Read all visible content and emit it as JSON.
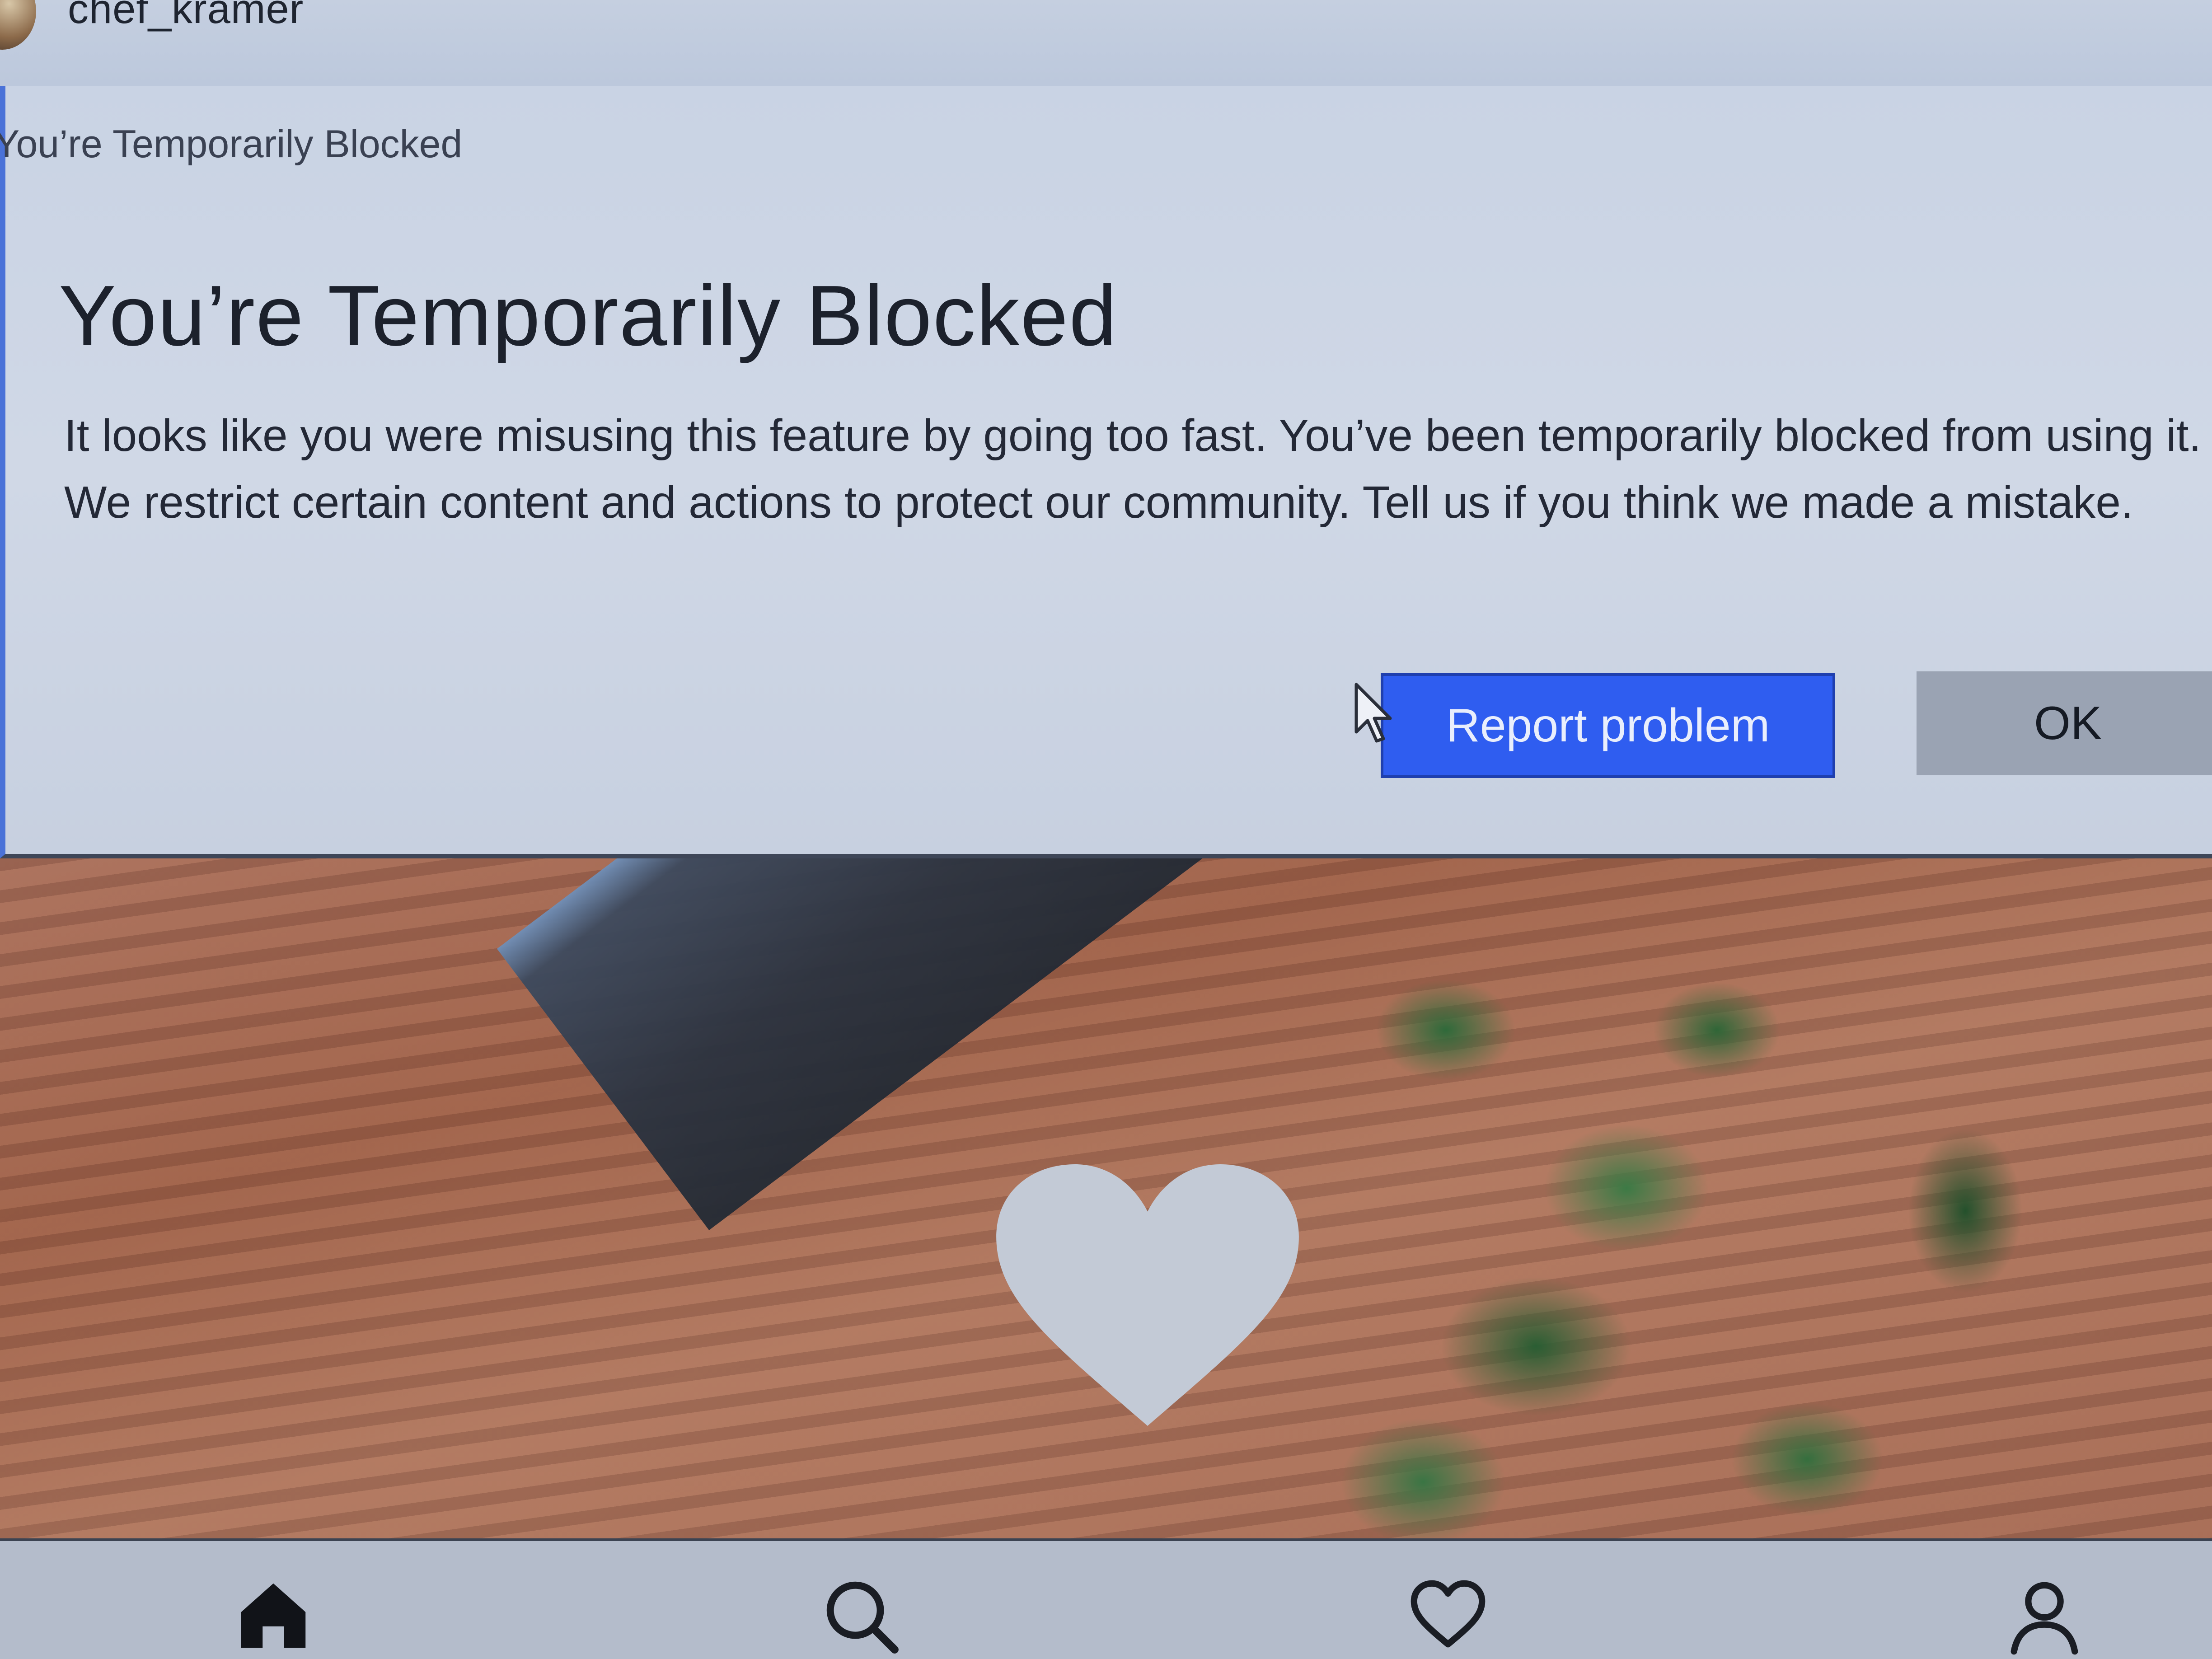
{
  "post": {
    "username": "chef_kramer"
  },
  "dialog": {
    "window_title": "You’re Temporarily Blocked",
    "heading": "You’re Temporarily Blocked",
    "message": "It looks like you were misusing this feature by going too fast. You’ve been temporarily blocked from using it. We restrict certain content and actions to protect our community. Tell us if you think we made a mistake.",
    "report_label": "Report problem",
    "ok_label": "OK"
  },
  "colors": {
    "accent_blue": "#2f5df0",
    "ok_button_gray": "#9aa3b3",
    "dialog_background": "#cdd5e4"
  },
  "icons": {
    "nav": [
      "home-icon",
      "search-icon",
      "heart-icon",
      "profile-icon"
    ],
    "overlay": "like-heart-icon",
    "pointer": "mouse-cursor-icon"
  }
}
